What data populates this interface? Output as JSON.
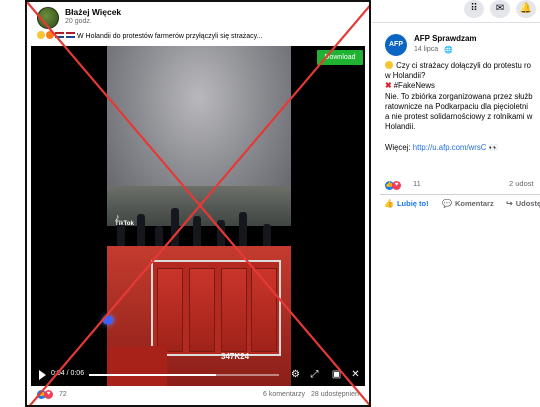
{
  "left_post": {
    "author": "Błażej Więcek",
    "time": "20 godz.",
    "caption": "W Holandii do protestów farmerów przyłączyli się strażacy...",
    "download_label": "Download",
    "tiktok_label": "TikTok",
    "truck_number": "347K24",
    "video_time": "0:04 / 0:06",
    "progress_fraction": 0.67,
    "reactions_count": "72",
    "comments": "6 komentarzy",
    "shares": "28 udostępnień",
    "icons": [
      "play-icon",
      "gear-icon",
      "expand-icon",
      "pip-icon",
      "mute-icon"
    ]
  },
  "overlay": {
    "cross_color": "#e53935"
  },
  "right_post": {
    "page_name": "AFP Sprawdzam",
    "logo_text": "AFP",
    "date": "14 lipca",
    "lines": {
      "l1": "Czy ci strażacy dołączyli do protestu ro",
      "l2": "w Holandii?",
      "l3": "#FakeNews",
      "l4": "Nie. To zbiórka zorganizowana przez służb",
      "l5": "ratownicze na Podkarpaciu dla pięcioletni",
      "l6": "a nie protest solidarnościowy z rolnikami w",
      "l7": "Holandii.",
      "l8_prefix": "Więcej: ",
      "l8_link": "http://u.afp.com/wrsC"
    },
    "reactions_count": "11",
    "shares_partial": "2 udost",
    "actions": {
      "like": "Lubię to!",
      "comment": "Komentarz",
      "share": "Udostę"
    },
    "top_icons": [
      "grid-icon",
      "messenger-icon",
      "bell-icon"
    ]
  },
  "colors": {
    "facebook_blue": "#1877f2",
    "download_green": "#20b232",
    "link_blue": "#216fdb"
  }
}
